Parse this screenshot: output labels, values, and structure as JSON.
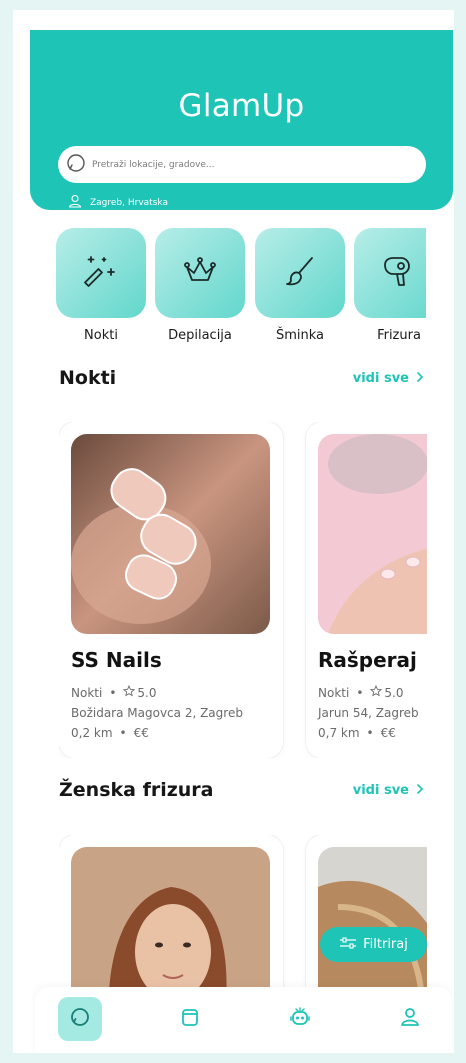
{
  "app": {
    "title": "GlamUp"
  },
  "search": {
    "placeholder": "Pretraži lokacije, gradove..."
  },
  "location": {
    "label": "Zagreb, Hrvatska"
  },
  "categories": [
    {
      "label": "Nokti",
      "icon": "magic-wand-icon"
    },
    {
      "label": "Depilacija",
      "icon": "crown-icon"
    },
    {
      "label": "Šminka",
      "icon": "brush-icon"
    },
    {
      "label": "Frizura",
      "icon": "hair-dryer-icon"
    }
  ],
  "sections": [
    {
      "title": "Nokti",
      "see_all": "vidi sve",
      "salons": [
        {
          "name": "SS Nails",
          "category": "Nokti",
          "rating": "5.0",
          "address": "Božidara Magovca 2, Zagreb",
          "distance": "0,2 km",
          "price": "€€"
        },
        {
          "name": "Rašperaj",
          "category": "Nokti",
          "rating": "5.0",
          "address": "Jarun 54, Zagreb",
          "distance": "0,7 km",
          "price": "€€"
        }
      ]
    },
    {
      "title": "Ženska frizura",
      "see_all": "vidi sve",
      "salons": []
    }
  ],
  "filter": {
    "label": "Filtriraj"
  },
  "bottom_nav": [
    {
      "icon": "search-icon",
      "active": true
    },
    {
      "icon": "calendar-icon",
      "active": false
    },
    {
      "icon": "robot-icon",
      "active": false
    },
    {
      "icon": "user-icon",
      "active": false
    }
  ],
  "colors": {
    "accent": "#1ec4b6",
    "background": "#e4f5f4",
    "nav_active": "#a4e9e2"
  }
}
